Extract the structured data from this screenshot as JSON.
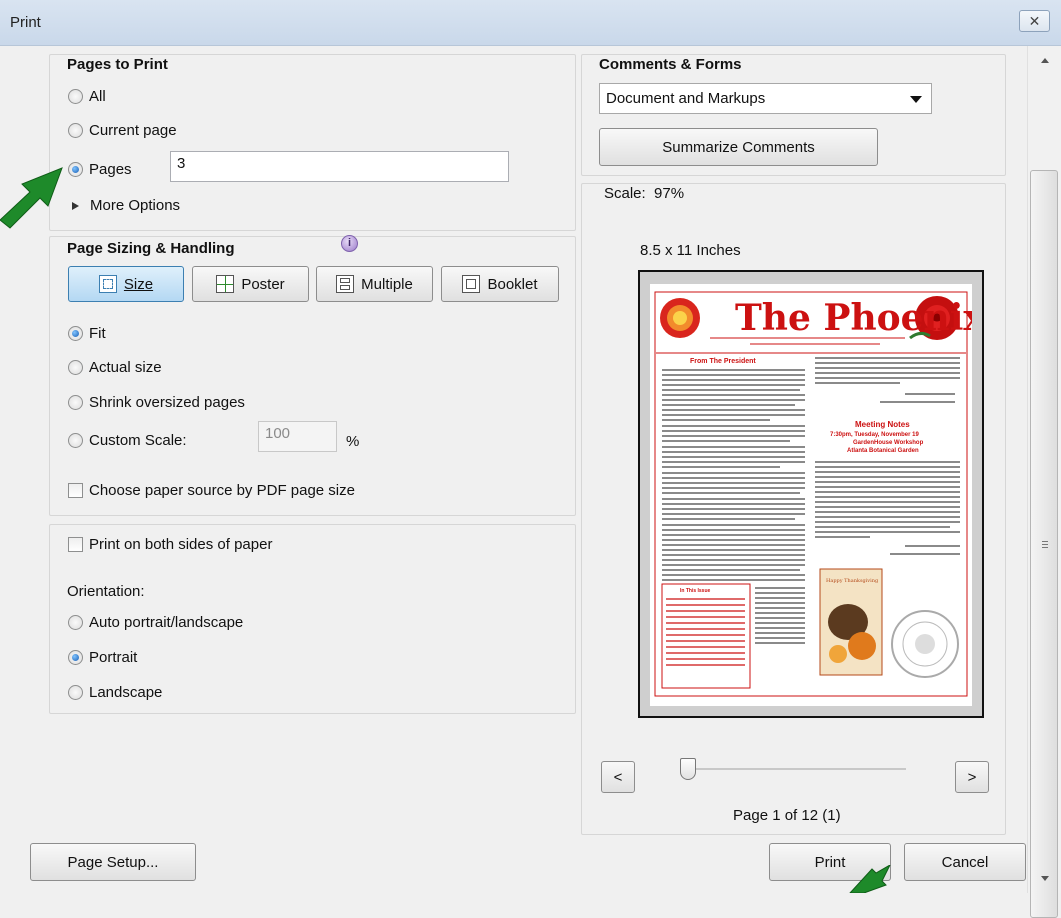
{
  "window": {
    "title": "Print",
    "close_symbol": "✕"
  },
  "pages_to_print": {
    "heading": "Pages to Print",
    "options": [
      "All",
      "Current page",
      "Pages"
    ],
    "selected": "Pages",
    "pages_value": "3",
    "more_options": "More Options"
  },
  "sizing": {
    "heading": "Page Sizing & Handling",
    "info_symbol": "i",
    "tabs": [
      "Size",
      "Poster",
      "Multiple",
      "Booklet"
    ],
    "active_tab": "Size",
    "options": [
      "Fit",
      "Actual size",
      "Shrink oversized pages",
      "Custom Scale:"
    ],
    "selected": "Fit",
    "custom_scale_value": "100",
    "percent_symbol": "%",
    "paper_source_label": "Choose paper source by PDF page size"
  },
  "duplex": {
    "both_sides_label": "Print on both sides of paper",
    "orientation_label": "Orientation:",
    "orientation_options": [
      "Auto portrait/landscape",
      "Portrait",
      "Landscape"
    ],
    "orientation_selected": "Portrait"
  },
  "comments": {
    "heading": "Comments & Forms",
    "selected": "Document and Markups",
    "summarize_label": "Summarize Comments"
  },
  "preview": {
    "scale_text": "Scale:  97%",
    "paper_size": "8.5 x 11 Inches",
    "page_indicator": "Page 1 of 12 (1)",
    "prev_symbol": "<",
    "next_symbol": ">",
    "slider_fraction": 0,
    "newsletter_title": "The Phoenix",
    "section_heading": "From The President",
    "meeting_heading": "Meeting Notes",
    "meeting_sub": "7:30pm, Tuesday, November 19",
    "meeting_place": "GardenHouse Workshop",
    "meeting_place2": "Atlanta Botanical Garden",
    "thanksgiving": "Happy Thanksgiving",
    "in_this_issue": "In This Issue"
  },
  "footer": {
    "page_setup_label": "Page Setup...",
    "print_label": "Print",
    "cancel_label": "Cancel"
  },
  "colors": {
    "accent_green": "#1e8a2a",
    "newsletter_red": "#cc1111",
    "title_bar": "#d3dfee"
  }
}
